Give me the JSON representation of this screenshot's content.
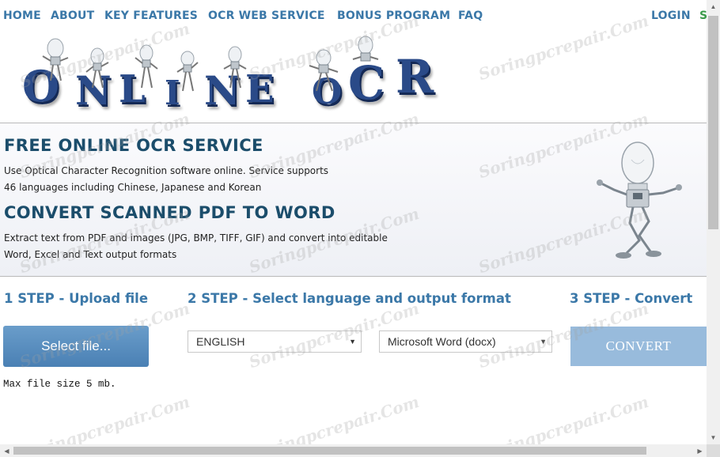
{
  "nav": {
    "items": [
      "HOME",
      "ABOUT",
      "KEY FEATURES",
      "OCR WEB SERVICE",
      "BONUS PROGRAM",
      "FAQ"
    ],
    "login": "LOGIN",
    "signup_partial": "S"
  },
  "logo": {
    "letters": [
      "O",
      "N",
      "L",
      "I",
      "N",
      "E",
      "O",
      "C",
      "R"
    ],
    "alt": "robot-mascot-icon"
  },
  "hero": {
    "title1": "FREE ONLINE OCR SERVICE",
    "text1_line1": "Use Optical Character Recognition software online. Service supports",
    "text1_line2": "46 languages including Chinese, Japanese and Korean",
    "title2": "CONVERT SCANNED PDF TO WORD",
    "text2_line1": "Extract text from PDF and images (JPG, BMP, TIFF, GIF) and convert into editable",
    "text2_line2": "Word, Excel and Text output formats",
    "mascot_icon": "robot-mascot-icon"
  },
  "steps": {
    "step1": "1 STEP - Upload file",
    "step2": "2 STEP - Select language and output format",
    "step3": "3 STEP - Convert"
  },
  "upload": {
    "button_label": "Select file...",
    "max_size": "Max file size 5 mb."
  },
  "language_select": {
    "value": "ENGLISH"
  },
  "format_select": {
    "value": "Microsoft Word (docx)"
  },
  "convert": {
    "label": "CONVERT"
  },
  "watermark": "Soringpcrepair.Com",
  "colors": {
    "nav": "#3b78a8",
    "title": "#1b4d6b",
    "select_button": "#5a90c2",
    "convert_button": "#98bbdc"
  }
}
